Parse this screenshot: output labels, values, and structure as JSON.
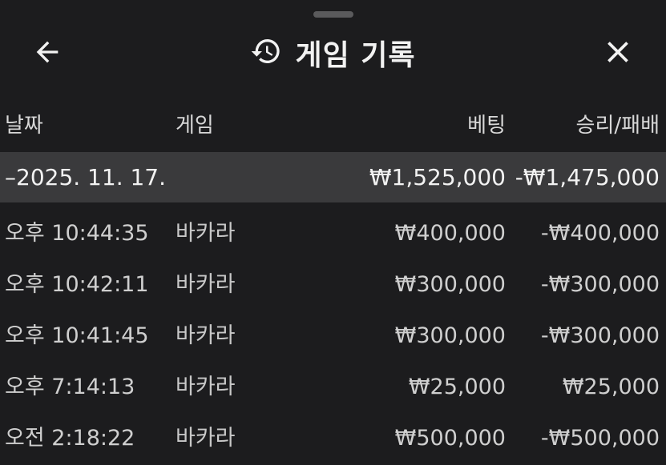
{
  "header": {
    "title": "게임 기록",
    "back_icon": "arrow-left-icon",
    "history_icon": "history-icon",
    "close_icon": "close-icon"
  },
  "columns": {
    "date": "날짜",
    "game": "게임",
    "bet": "베팅",
    "result": "승리/패배"
  },
  "group": {
    "date": "–2025. 11. 17.",
    "bet": "₩1,525,000",
    "result": "-₩1,475,000"
  },
  "rows": [
    {
      "time": "오후 10:44:35",
      "game": "바카라",
      "bet": "₩400,000",
      "result": "-₩400,000"
    },
    {
      "time": "오후 10:42:11",
      "game": "바카라",
      "bet": "₩300,000",
      "result": "-₩300,000"
    },
    {
      "time": "오후 10:41:45",
      "game": "바카라",
      "bet": "₩300,000",
      "result": "-₩300,000"
    },
    {
      "time": "오후 7:14:13",
      "game": "바카라",
      "bet": "₩25,000",
      "result": "₩25,000"
    },
    {
      "time": "오전 2:18:22",
      "game": "바카라",
      "bet": "₩500,000",
      "result": "-₩500,000"
    }
  ]
}
